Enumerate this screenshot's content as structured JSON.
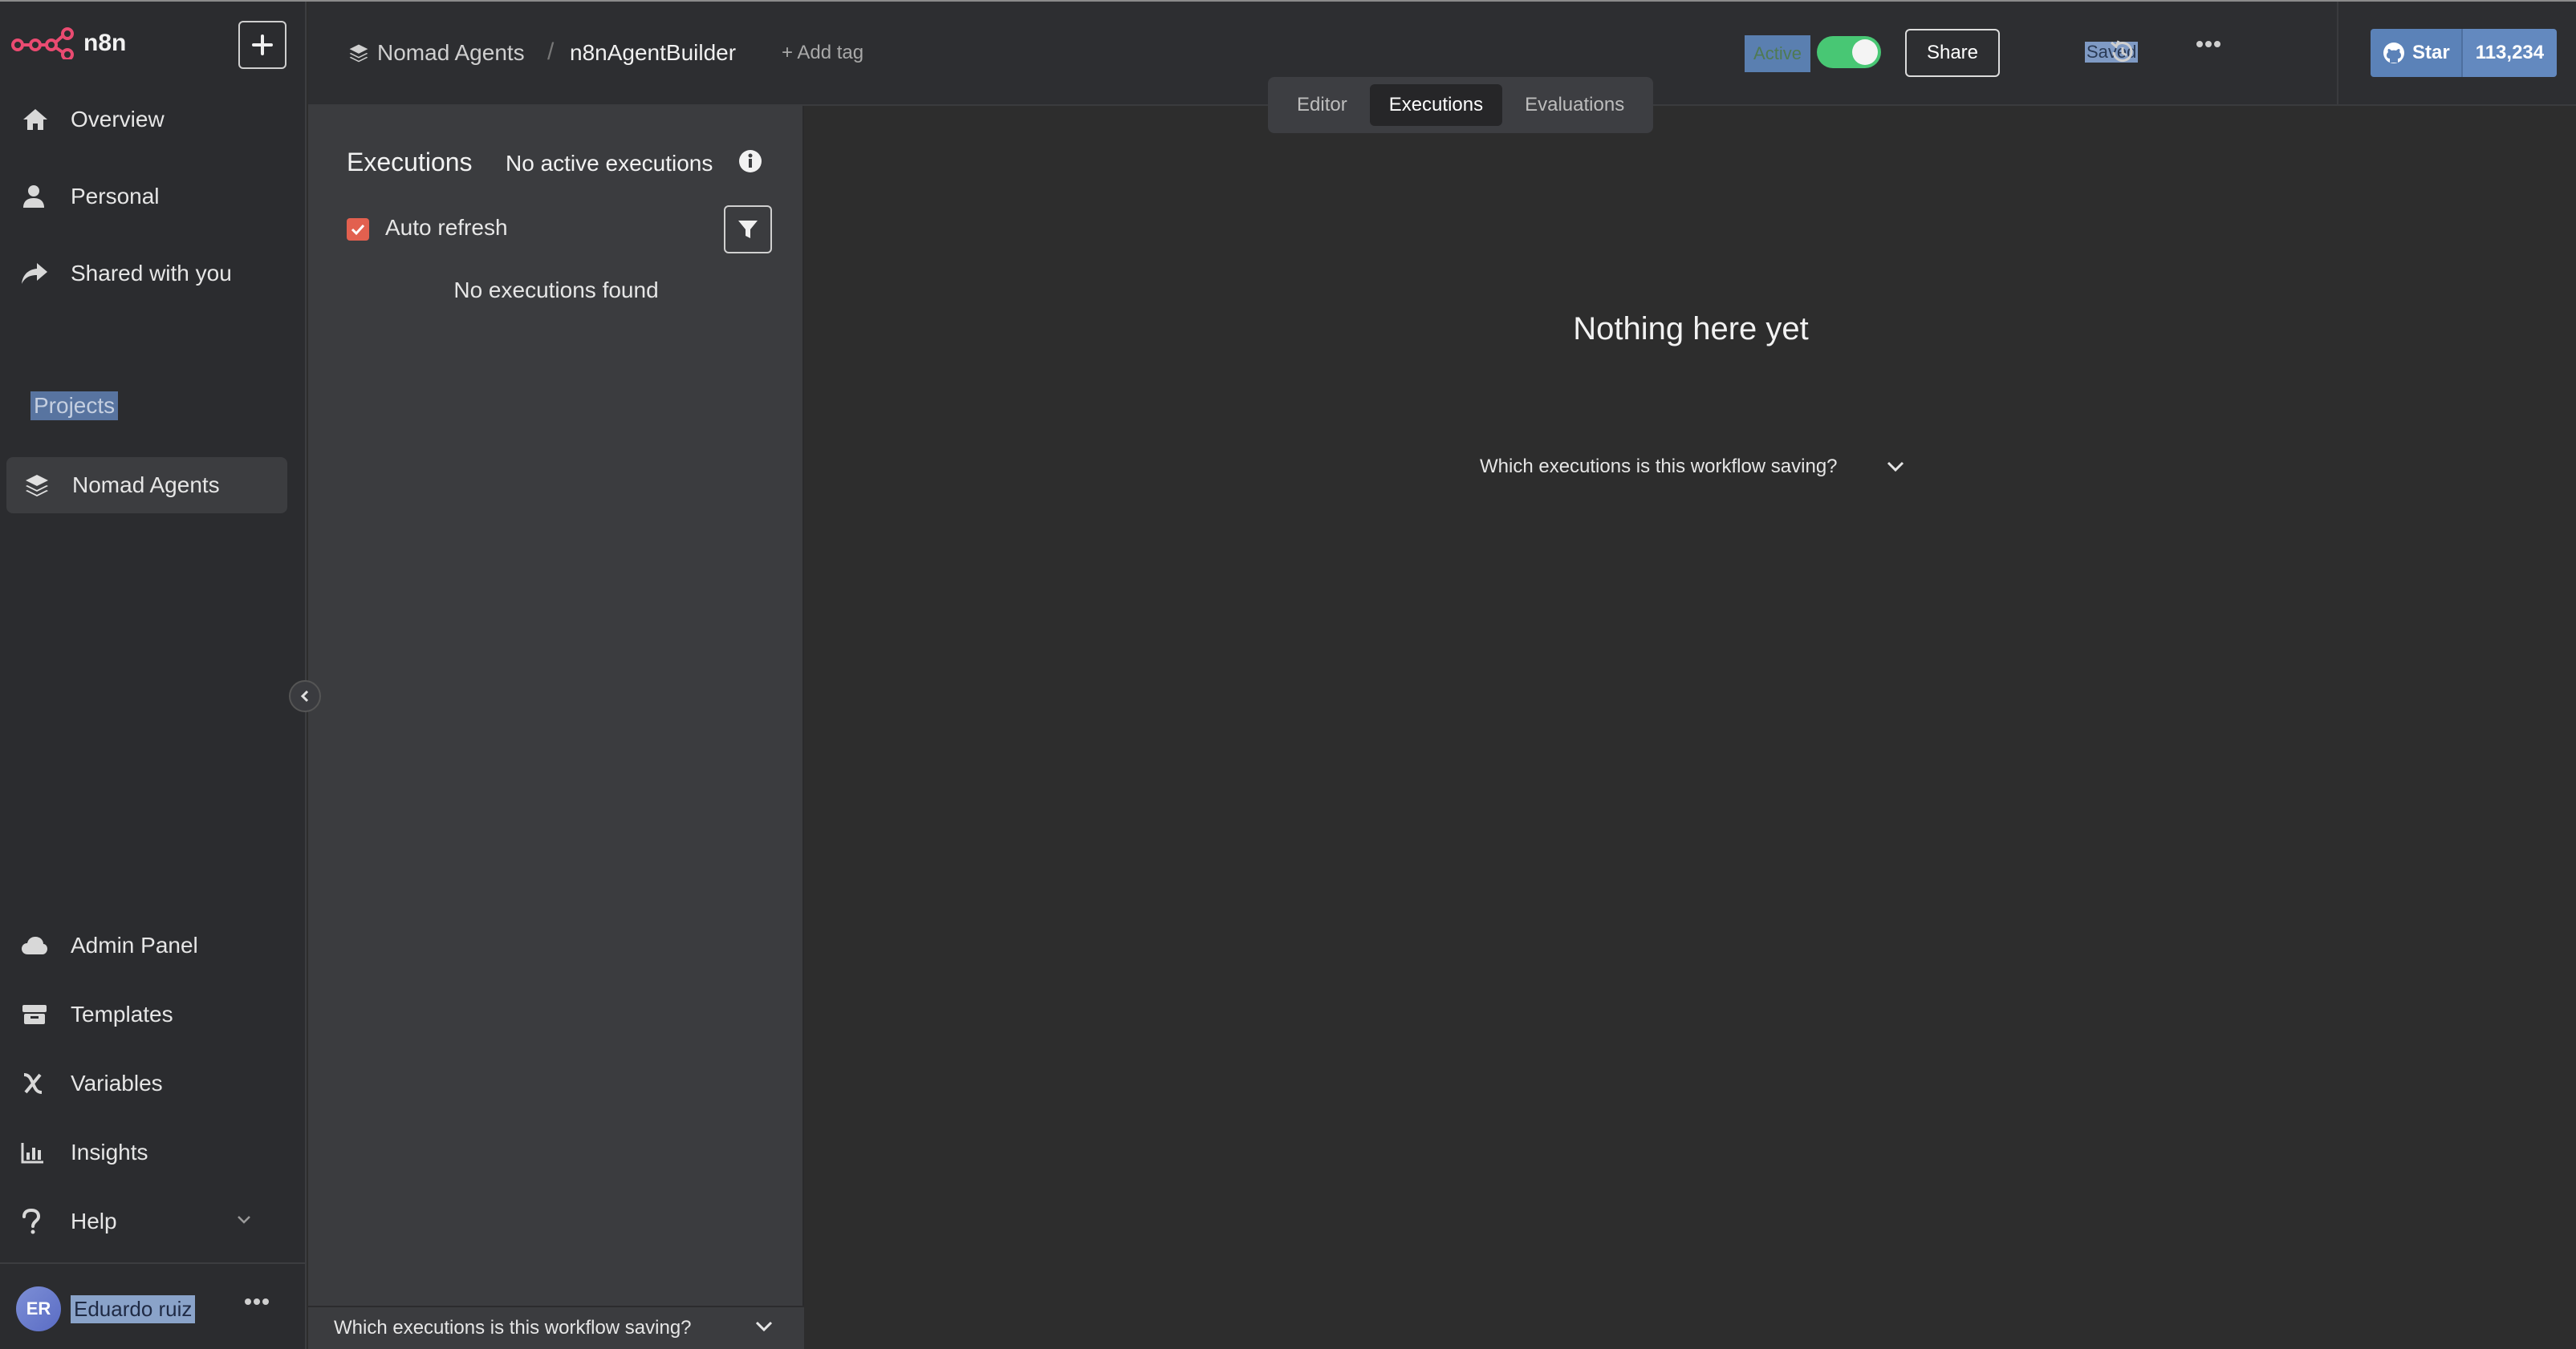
{
  "app": {
    "name": "n8n"
  },
  "sidebar": {
    "nav": [
      {
        "label": "Overview",
        "icon": "home-icon"
      },
      {
        "label": "Personal",
        "icon": "user-icon"
      },
      {
        "label": "Shared with you",
        "icon": "share-icon"
      }
    ],
    "projects_label": "Projects",
    "project_item": {
      "label": "Nomad Agents",
      "icon": "layers-icon"
    },
    "bottom_nav": [
      {
        "label": "Admin Panel",
        "icon": "cloud-icon"
      },
      {
        "label": "Templates",
        "icon": "box-icon"
      },
      {
        "label": "Variables",
        "icon": "variable-icon"
      },
      {
        "label": "Insights",
        "icon": "chart-icon"
      },
      {
        "label": "Help",
        "icon": "question-icon"
      }
    ],
    "user": {
      "initials": "ER",
      "name": "Eduardo ruiz"
    }
  },
  "header": {
    "breadcrumb_project": "Nomad Agents",
    "breadcrumb_separator": "/",
    "workflow_name": "n8nAgentBuilder",
    "add_tag": "+ Add tag",
    "tabs": [
      {
        "label": "Editor",
        "active": false
      },
      {
        "label": "Executions",
        "active": true
      },
      {
        "label": "Evaluations",
        "active": false
      }
    ],
    "active_label": "Active",
    "active_on": true,
    "share_label": "Share",
    "saved_label": "Saved",
    "github": {
      "star_label": "Star",
      "count": "113,234"
    }
  },
  "executions_panel": {
    "title": "Executions",
    "status": "No active executions",
    "auto_refresh_label": "Auto refresh",
    "auto_refresh_checked": true,
    "empty_text": "No executions found",
    "footer_text": "Which executions is this workflow saving?"
  },
  "main": {
    "title": "Nothing here yet",
    "saving_question": "Which executions is this workflow saving?"
  },
  "colors": {
    "accent": "#ea4b71",
    "toggle_on": "#48c774",
    "checkbox": "#e2604f",
    "github_blue": "#5b82b8"
  }
}
